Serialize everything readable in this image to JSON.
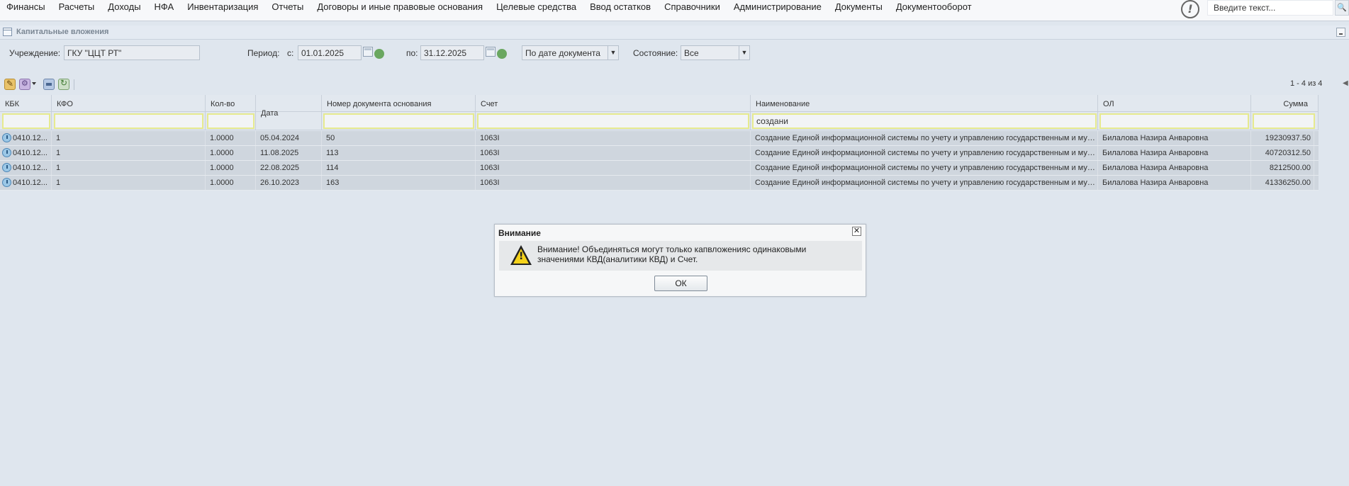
{
  "menu": {
    "items": [
      "Финансы",
      "Расчеты",
      "Доходы",
      "НФА",
      "Инвентаризация",
      "Отчеты",
      "Договоры и иные правовые основания",
      "Целевые средства",
      "Ввод остатков",
      "Справочники",
      "Администрирование",
      "Документы",
      "Документооборот"
    ],
    "alert_icon": "!",
    "search_placeholder": "Введите текст...",
    "search_icon": "🔍"
  },
  "panel": {
    "title": "Капитальные вложения"
  },
  "filters": {
    "institution_label": "Учреждение:",
    "institution_value": "ГКУ \"ЦЦТ РТ\"",
    "period_label": "Период:",
    "from_label": "с:",
    "from_value": "01.01.2025",
    "to_label": "по:",
    "to_value": "31.12.2025",
    "date_mode": "По дате документа",
    "state_label": "Состояние:",
    "state_value": "Все"
  },
  "toolbar": {
    "paging": "1 - 4 из 4"
  },
  "grid": {
    "columns": [
      "КБК",
      "КФО",
      "Кол-во",
      "Дата",
      "Номер документа основания",
      "Счет",
      "Наименование",
      "ОЛ",
      "Сумма"
    ],
    "filter_name": "создани",
    "rows": [
      {
        "kbk": "0410.12...",
        "kfo": "1",
        "qty": "1.0000",
        "date": "05.04.2024",
        "doc": "50",
        "acc": "1063I",
        "name": "Создание Единой информационной системы по учету и управлению государственным и мун...",
        "ol": "Билалова Назира Анваровна",
        "sum": "19230937.50"
      },
      {
        "kbk": "0410.12...",
        "kfo": "1",
        "qty": "1.0000",
        "date": "11.08.2025",
        "doc": "113",
        "acc": "1063I",
        "name": "Создание Единой информационной системы по учету и управлению государственным и мун...",
        "ol": "Билалова Назира Анваровна",
        "sum": "40720312.50"
      },
      {
        "kbk": "0410.12...",
        "kfo": "1",
        "qty": "1.0000",
        "date": "22.08.2025",
        "doc": "114",
        "acc": "1063I",
        "name": "Создание Единой информационной системы по учету и управлению государственным и мун...",
        "ol": "Билалова Назира Анваровна",
        "sum": "8212500.00"
      },
      {
        "kbk": "0410.12...",
        "kfo": "1",
        "qty": "1.0000",
        "date": "26.10.2023",
        "doc": "163",
        "acc": "1063I",
        "name": "Создание Единой информационной системы по учету и управлению государственным и мун...",
        "ol": "Билалова Назира Анваровна",
        "sum": "41336250.00"
      }
    ]
  },
  "dialog": {
    "title": "Внимание",
    "close": "✕",
    "line1": "Внимание! Объединяться могут только капвложенияс одинаковыми",
    "line2": "значениями КВД(аналитики КВД) и Счет.",
    "ok_label": "ОК"
  }
}
